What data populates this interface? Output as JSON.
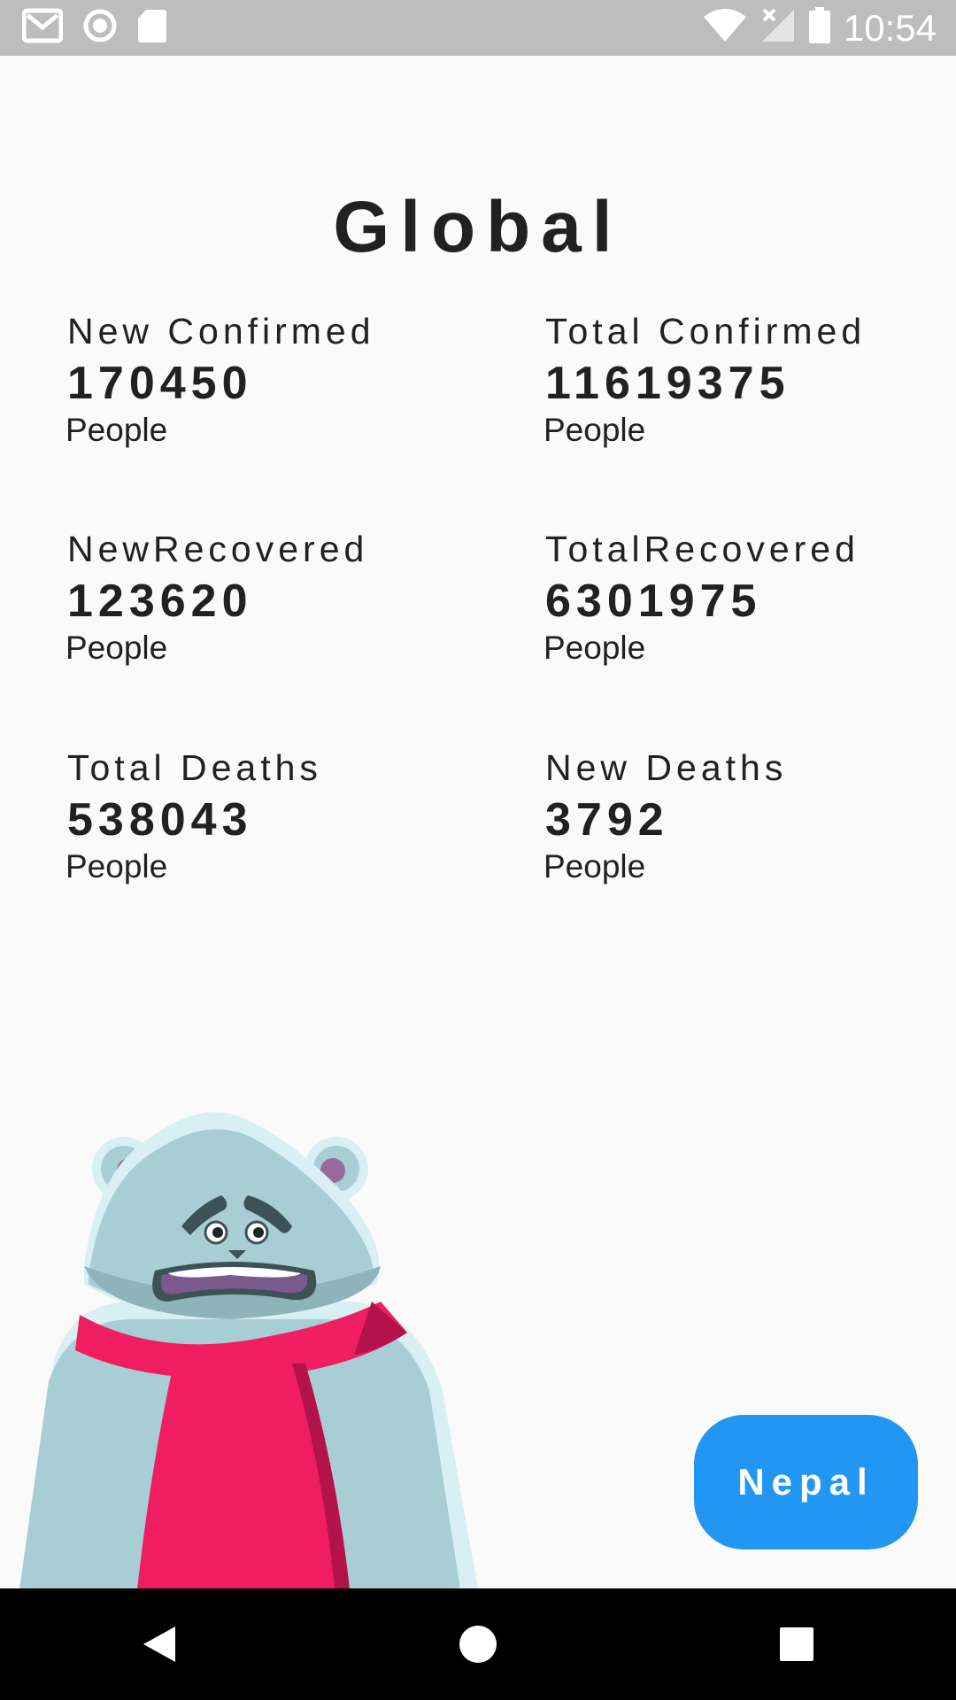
{
  "status_bar": {
    "time": "10:54",
    "icons": [
      "gmail-icon",
      "record-icon",
      "sd-card-icon",
      "wifi-icon",
      "no-signal-icon",
      "battery-icon"
    ]
  },
  "page": {
    "title": "Global"
  },
  "stats": [
    {
      "label": "New Confirmed",
      "value": "170450",
      "unit": "People"
    },
    {
      "label": "Total Confirmed",
      "value": "11619375",
      "unit": "People"
    },
    {
      "label": "NewRecovered",
      "value": "123620",
      "unit": "People"
    },
    {
      "label": "TotalRecovered",
      "value": "6301975",
      "unit": "People"
    },
    {
      "label": "Total Deaths",
      "value": "538043",
      "unit": "People"
    },
    {
      "label": "New Deaths",
      "value": "3792",
      "unit": "People"
    }
  ],
  "actions": {
    "country_button": "Nepal"
  },
  "nav_bar": {
    "icons": [
      "back-icon",
      "home-icon",
      "recents-icon"
    ]
  },
  "colors": {
    "accent": "#2196f3",
    "background": "#fafafa",
    "text": "#212121",
    "scarf": "#ef1e63",
    "bear_fur": "#a9cdd4"
  }
}
